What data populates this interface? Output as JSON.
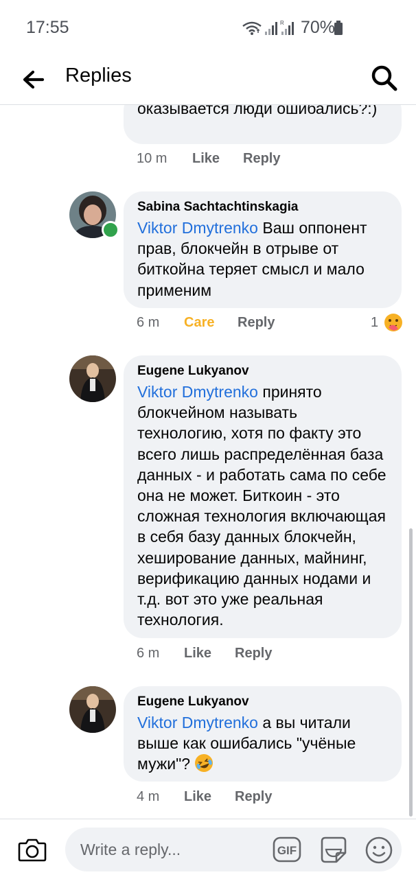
{
  "status_bar": {
    "time": "17:55",
    "battery": "70%"
  },
  "header": {
    "title": "Replies",
    "back_icon": "arrow-left-icon",
    "search_icon": "search-icon"
  },
  "comments": [
    {
      "text": "оказывается люди ошибались?:)",
      "time": "10 m",
      "like_label": "Like",
      "reply_label": "Reply"
    },
    {
      "author": "Sabina  Sachtachtinskagia",
      "mention": "Viktor Dmytrenko",
      "text": " Ваш оппонент прав, блокчейн в отрыве от биткойна теряет смысл и мало применим",
      "time": "6 m",
      "reaction_label": "Care",
      "reply_label": "Reply",
      "reaction_count": "1",
      "online": true
    },
    {
      "author": "Eugene Lukyanov",
      "mention": "Viktor Dmytrenko",
      "text": " принято блокчейном называть технологию, хотя по факту это всего лишь распределённая база данных - и работать сама по себе она не может. Биткоин - это сложная технология включающая в себя базу данных блокчейн, хеширование данных, майнинг, верификацию данных нодами и т.д. вот это уже реальная технология.",
      "time": "6 m",
      "like_label": "Like",
      "reply_label": "Reply"
    },
    {
      "author": "Eugene Lukyanov",
      "mention": "Viktor Dmytrenko",
      "text": " а вы читали выше как ошибались \"учёные мужи\"? ",
      "time": "4 m",
      "like_label": "Like",
      "reply_label": "Reply"
    }
  ],
  "composer": {
    "placeholder": "Write a reply...",
    "gif_label": "GIF"
  },
  "colors": {
    "mention": "#216fdb",
    "care": "#f7b125",
    "bubble": "#f0f2f5",
    "online": "#31a24c"
  }
}
